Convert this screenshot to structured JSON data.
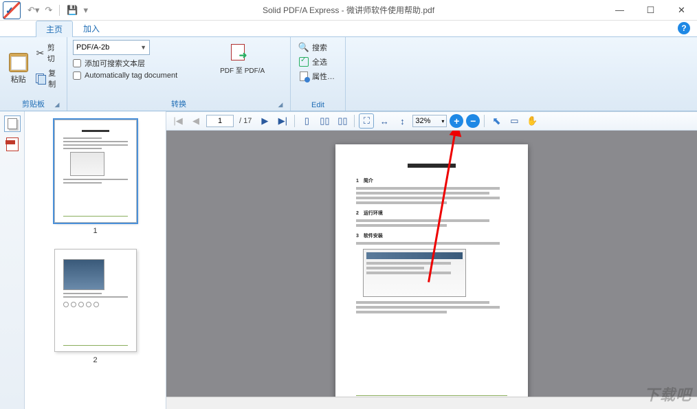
{
  "titlebar": {
    "app_name": "Solid PDF/A Express",
    "document_name": "微讲师软件使用帮助.pdf",
    "separator": " - "
  },
  "tabs": {
    "home": "主页",
    "add": "加入"
  },
  "ribbon": {
    "clipboard": {
      "group_label": "剪贴板",
      "paste": "粘贴",
      "cut": "剪切",
      "copy": "复制"
    },
    "convert": {
      "group_label": "转换",
      "format_selected": "PDF/A-2b",
      "opt_searchable": "添加可搜索文本层",
      "opt_autotag": "Automatically tag document",
      "action_label": "PDF 至 PDF/A"
    },
    "edit": {
      "group_label": "Edit",
      "search": "搜索",
      "select_all": "全选",
      "properties": "属性…"
    }
  },
  "nav": {
    "current_page": "1",
    "total_pages_label": "/ 17",
    "zoom_level": "32%"
  },
  "thumbnails": {
    "pages": [
      "1",
      "2"
    ]
  },
  "document": {
    "title_text": "微讲师软件使用帮助",
    "sec1": "1　简介",
    "sec2": "2　运行环境",
    "sec3": "3　软件安装"
  },
  "watermark": "下载吧"
}
